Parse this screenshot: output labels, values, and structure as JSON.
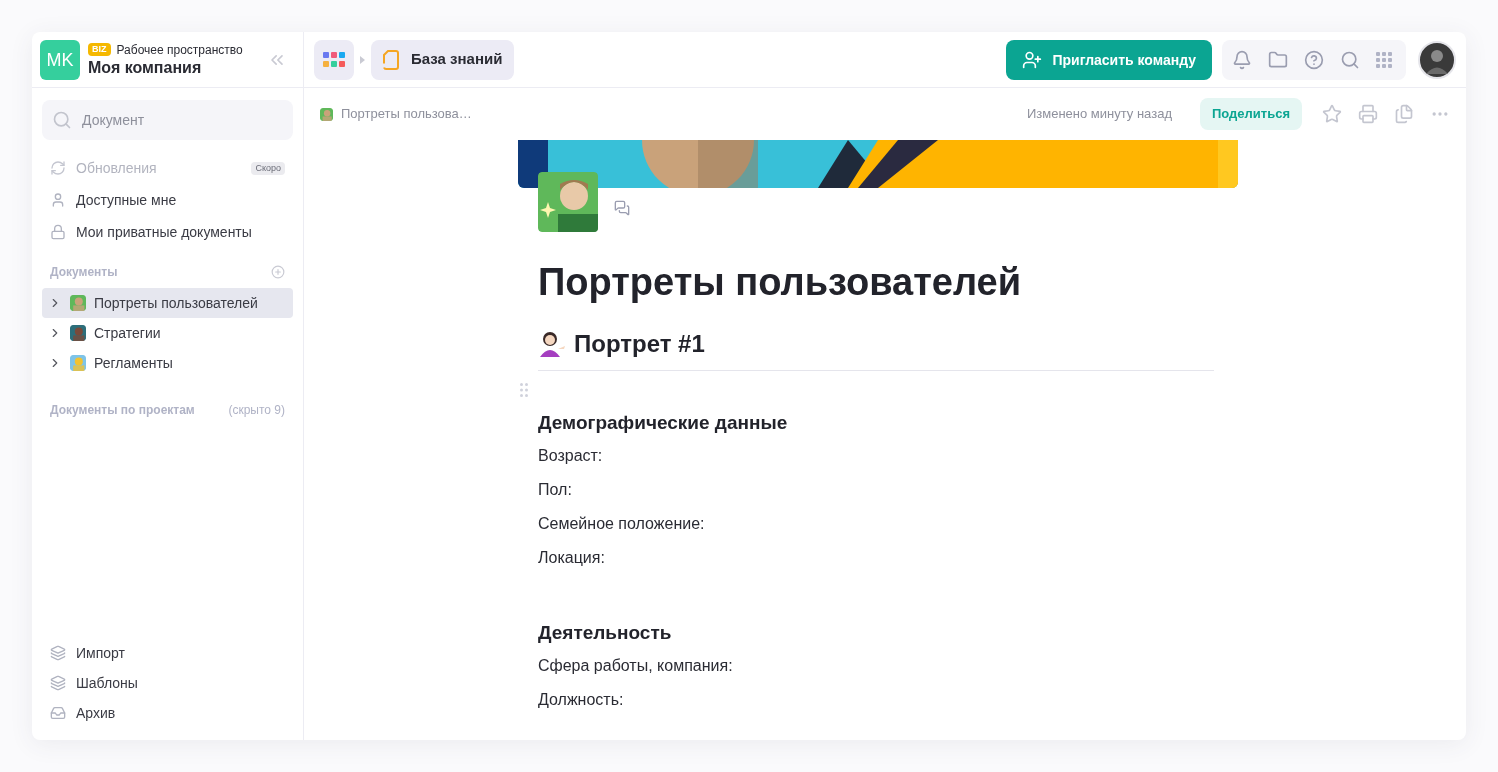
{
  "workspace": {
    "avatar": "MK",
    "badge": "BIZ",
    "label": "Рабочее пространство",
    "name": "Моя компания"
  },
  "sidebar": {
    "search": {
      "placeholder": "Документ"
    },
    "nav": [
      {
        "label": "Обновления",
        "badge": "Скоро",
        "disabled": true
      },
      {
        "label": "Доступные мне",
        "disabled": false
      },
      {
        "label": "Мои приватные документы",
        "disabled": false
      }
    ],
    "documents_header": "Документы",
    "documents": [
      {
        "label": "Портреты пользователей",
        "selected": true
      },
      {
        "label": "Стратегии",
        "selected": false
      },
      {
        "label": "Регламенты",
        "selected": false
      }
    ],
    "projects_header": "Документы по проектам",
    "projects_hidden": "(скрыто 9)",
    "footer": [
      {
        "label": "Импорт"
      },
      {
        "label": "Шаблоны"
      },
      {
        "label": "Архив"
      }
    ]
  },
  "topbar": {
    "breadcrumb": "База знаний",
    "invite_button": "Пригласить команду"
  },
  "doc_toolbar": {
    "breadcrumb": "Портреты пользова…",
    "modified": "Изменено минуту назад",
    "share_button": "Поделиться"
  },
  "document": {
    "title": "Портреты пользователей",
    "section": "Портрет #1",
    "blocks": [
      {
        "kind": "heading",
        "text": "Демографические данные"
      },
      {
        "kind": "field",
        "text": "Возраст:"
      },
      {
        "kind": "field",
        "text": "Пол:"
      },
      {
        "kind": "field",
        "text": "Семейное положение:"
      },
      {
        "kind": "field",
        "text": "Локация:"
      },
      {
        "kind": "heading",
        "text": "Деятельность"
      },
      {
        "kind": "field",
        "text": "Сфера работы, компания:"
      },
      {
        "kind": "field",
        "text": "Должность:"
      }
    ]
  }
}
